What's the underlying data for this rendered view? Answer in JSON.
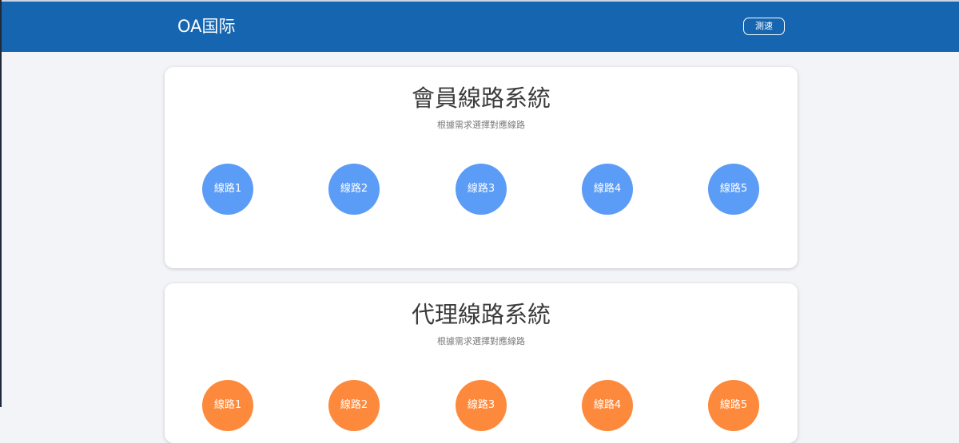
{
  "header": {
    "brand": "OA国际",
    "speed_test_label": "測速"
  },
  "sections": [
    {
      "title": "會員線路系統",
      "subtitle": "根據需求選擇對應線路",
      "color": "#5b9cf6",
      "lines": [
        "線路1",
        "線路2",
        "線路3",
        "線路4",
        "線路5"
      ]
    },
    {
      "title": "代理線路系統",
      "subtitle": "根據需求選擇對應線路",
      "color": "#fd8a3c",
      "lines": [
        "線路1",
        "線路2",
        "線路3",
        "線路4",
        "線路5"
      ]
    }
  ],
  "colors": {
    "header_bg": "#1565b0",
    "page_bg": "#f3f4f8"
  }
}
